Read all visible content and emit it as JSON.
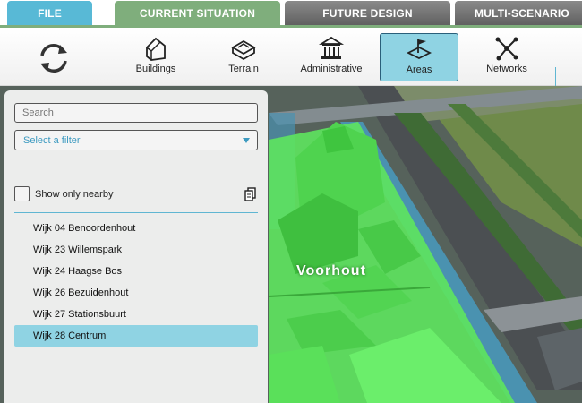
{
  "tabs": {
    "file": "FILE",
    "current": "CURRENT SITUATION",
    "future": "FUTURE DESIGN",
    "multi": "MULTI-SCENARIO"
  },
  "toolbar": {
    "buildings": "Buildings",
    "terrain": "Terrain",
    "administrative": "Administrative",
    "areas": "Areas",
    "networks": "Networks"
  },
  "panel": {
    "search_placeholder": "Search",
    "filter_label": "Select a filter",
    "nearby_label": "Show only nearby",
    "items": [
      "Wijk 04 Benoordenhout",
      "Wijk 23 Willemspark",
      "Wijk 24 Haagse Bos",
      "Wijk 26 Bezuidenhout",
      "Wijk 27 Stationsbuurt",
      "Wijk 28 Centrum"
    ],
    "selected_item": "Wijk 28 Centrum"
  },
  "map": {
    "area_label": "Voorhout"
  },
  "colors": {
    "accent": "#58b9d6",
    "active_tab": "#7fae7c",
    "selected": "#8fd3e3",
    "highlight_area": "#5ee65e"
  }
}
